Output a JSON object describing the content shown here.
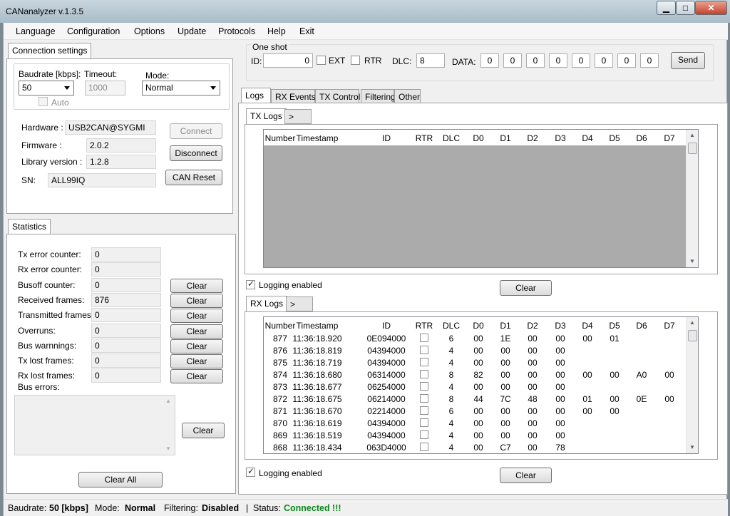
{
  "window": {
    "title": "CANanalyzer v.1.3.5",
    "min_glyph": "▁",
    "max_glyph": "□",
    "close_glyph": "✕"
  },
  "menu": [
    "Language",
    "Configuration",
    "Options",
    "Update",
    "Protocols",
    "Help",
    "Exit"
  ],
  "connection": {
    "tab": "Connection settings",
    "baudrate_label": "Baudrate [kbps]:",
    "baudrate_value": "50",
    "timeout_label": "Timeout:",
    "timeout_value": "1000",
    "mode_label": "Mode:",
    "mode_value": "Normal",
    "auto_label": "Auto",
    "hardware_label": "Hardware :",
    "hardware_value": "USB2CAN@SYGMI",
    "firmware_label": "Firmware :",
    "firmware_value": "2.0.2",
    "library_label": "Library version :",
    "library_value": "1.2.8",
    "sn_label": "SN:",
    "sn_value": "ALL99IQ",
    "connect_label": "Connect",
    "disconnect_label": "Disconnect",
    "canreset_label": "CAN Reset"
  },
  "statistics": {
    "tab": "Statistics",
    "rows": [
      {
        "label": "Tx error counter:",
        "value": "0"
      },
      {
        "label": "Rx error counter:",
        "value": "0"
      },
      {
        "label": "Busoff counter:",
        "value": "0"
      },
      {
        "label": "Received frames:",
        "value": "876"
      },
      {
        "label": "Transmitted frames:",
        "value": "0"
      },
      {
        "label": "Overruns:",
        "value": "0"
      },
      {
        "label": "Bus warnnings:",
        "value": "0"
      },
      {
        "label": "Tx lost frames:",
        "value": "0"
      },
      {
        "label": "Rx lost frames:",
        "value": "0"
      }
    ],
    "clear_label": "Clear",
    "bus_errors_label": "Bus errors:",
    "clear_all_label": "Clear All"
  },
  "oneshot": {
    "title": "One shot",
    "id_label": "ID:",
    "id_value": "0",
    "ext_label": "EXT",
    "rtr_label": "RTR",
    "dlc_label": "DLC:",
    "dlc_value": "8",
    "data_label": "DATA:",
    "data": [
      "0",
      "0",
      "0",
      "0",
      "0",
      "0",
      "0",
      "0"
    ],
    "send_label": "Send"
  },
  "main_tabs": [
    "Logs",
    "RX Events",
    "TX Control",
    "Filtering",
    "Other"
  ],
  "tx_logs": {
    "tab": "TX Logs",
    "more": ">",
    "logging_label": "Logging enabled",
    "clear_label": "Clear"
  },
  "rx_logs": {
    "tab": "RX Logs",
    "more": ">",
    "logging_label": "Logging enabled",
    "clear_label": "Clear"
  },
  "columns": [
    "Number",
    "Timestamp",
    "ID",
    "RTR",
    "DLC",
    "D0",
    "D1",
    "D2",
    "D3",
    "D4",
    "D5",
    "D6",
    "D7"
  ],
  "rx_rows": [
    {
      "n": "877",
      "ts": "11:36:18.920",
      "id": "0E094000",
      "dlc": "6",
      "d": [
        "00",
        "1E",
        "00",
        "00",
        "00",
        "01",
        "",
        ""
      ]
    },
    {
      "n": "876",
      "ts": "11:36:18.819",
      "id": "04394000",
      "dlc": "4",
      "d": [
        "00",
        "00",
        "00",
        "00",
        "",
        "",
        "",
        ""
      ]
    },
    {
      "n": "875",
      "ts": "11:36:18.719",
      "id": "04394000",
      "dlc": "4",
      "d": [
        "00",
        "00",
        "00",
        "00",
        "",
        "",
        "",
        ""
      ]
    },
    {
      "n": "874",
      "ts": "11:36:18.680",
      "id": "06314000",
      "dlc": "8",
      "d": [
        "82",
        "00",
        "00",
        "00",
        "00",
        "00",
        "A0",
        "00"
      ]
    },
    {
      "n": "873",
      "ts": "11:36:18.677",
      "id": "06254000",
      "dlc": "4",
      "d": [
        "00",
        "00",
        "00",
        "00",
        "",
        "",
        "",
        ""
      ]
    },
    {
      "n": "872",
      "ts": "11:36:18.675",
      "id": "06214000",
      "dlc": "8",
      "d": [
        "44",
        "7C",
        "48",
        "00",
        "01",
        "00",
        "0E",
        "00"
      ]
    },
    {
      "n": "871",
      "ts": "11:36:18.670",
      "id": "02214000",
      "dlc": "6",
      "d": [
        "00",
        "00",
        "00",
        "00",
        "00",
        "00",
        "",
        ""
      ]
    },
    {
      "n": "870",
      "ts": "11:36:18.619",
      "id": "04394000",
      "dlc": "4",
      "d": [
        "00",
        "00",
        "00",
        "00",
        "",
        "",
        "",
        ""
      ]
    },
    {
      "n": "869",
      "ts": "11:36:18.519",
      "id": "04394000",
      "dlc": "4",
      "d": [
        "00",
        "00",
        "00",
        "00",
        "",
        "",
        "",
        ""
      ]
    },
    {
      "n": "868",
      "ts": "11:36:18.434",
      "id": "063D4000",
      "dlc": "4",
      "d": [
        "00",
        "C7",
        "00",
        "78",
        "",
        "",
        "",
        ""
      ]
    }
  ],
  "status": {
    "baudrate_label": "Baudrate:",
    "baudrate_value": "50 [kbps]",
    "mode_label": "Mode:",
    "mode_value": "Normal",
    "filtering_label": "Filtering:",
    "filtering_value": "Disabled",
    "sep": "|",
    "status_label": "Status:",
    "status_value": "Connected !!!",
    "status_color": "#0a8a1a"
  },
  "icons": {
    "scroll_up": "▲",
    "scroll_down": "▼",
    "check": "✓"
  }
}
